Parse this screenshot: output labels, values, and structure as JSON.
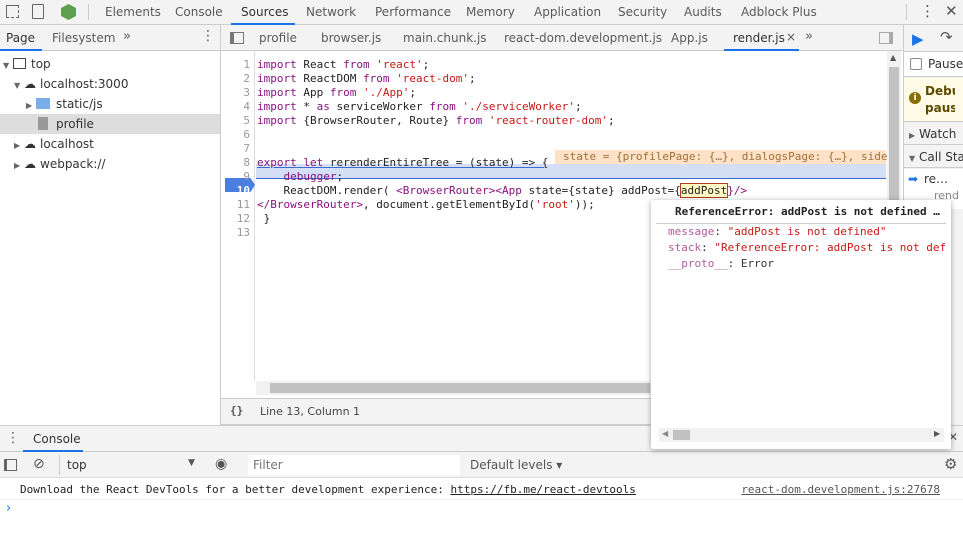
{
  "toolbar": {
    "tabs": [
      "Elements",
      "Console",
      "Sources",
      "Network",
      "Performance",
      "Memory",
      "Application",
      "Security",
      "Audits",
      "Adblock Plus"
    ],
    "active": "Sources"
  },
  "navigator": {
    "tabs": [
      "Page",
      "Filesystem"
    ],
    "more": "»",
    "tree": [
      "top",
      "localhost:3000",
      "static/js",
      "profile",
      "localhost",
      "webpack://"
    ]
  },
  "editor": {
    "tabs": [
      "profile",
      "browser.js",
      "main.chunk.js",
      "react-dom.development.js",
      "App.js",
      "render.js"
    ],
    "active_tab": "render.js",
    "close": "×",
    "more": "»",
    "lines": [
      [
        [
          "import",
          "kw"
        ],
        [
          " React ",
          "id"
        ],
        [
          "from",
          "kw"
        ],
        [
          " 'react'",
          "str"
        ],
        [
          ";",
          "id"
        ]
      ],
      [
        [
          "import",
          "kw"
        ],
        [
          " ReactDOM ",
          "id"
        ],
        [
          "from",
          "kw"
        ],
        [
          " 'react-dom'",
          "str"
        ],
        [
          ";",
          "id"
        ]
      ],
      [
        [
          "import",
          "kw"
        ],
        [
          " App ",
          "id"
        ],
        [
          "from",
          "kw"
        ],
        [
          " './App'",
          "str"
        ],
        [
          ";",
          "id"
        ]
      ],
      [
        [
          "import",
          "kw"
        ],
        [
          " * ",
          "id"
        ],
        [
          "as",
          "kw"
        ],
        [
          " serviceWorker ",
          "id"
        ],
        [
          "from",
          "kw"
        ],
        [
          " './serviceWorker'",
          "str"
        ],
        [
          ";",
          "id"
        ]
      ],
      [
        [
          "import",
          "kw"
        ],
        [
          " {BrowserRouter, Route} ",
          "id"
        ],
        [
          "from",
          "kw"
        ],
        [
          " 'react-router-dom'",
          "str"
        ],
        [
          ";",
          "id"
        ]
      ],
      [],
      [],
      [
        [
          "export",
          "kw"
        ],
        [
          " ",
          "id"
        ],
        [
          "let",
          "kw"
        ],
        [
          " rerenderEntireTree = (state) => {",
          "id"
        ]
      ],
      [
        [
          "    ",
          "id"
        ],
        [
          "debugger",
          "kw"
        ],
        [
          ";",
          "id"
        ]
      ],
      [
        [
          "    ReactDOM.render( ",
          "id"
        ],
        [
          "<BrowserRouter>",
          "tag"
        ],
        [
          "<App ",
          "tag"
        ],
        [
          "state={state} addPost={",
          "id"
        ],
        [
          "addPost",
          "id"
        ],
        [
          "}/>",
          "tag"
        ]
      ],
      [
        [
          "</BrowserRouter>",
          "tag"
        ],
        [
          ", document.getElementById(",
          "id"
        ],
        [
          "'root'",
          "str"
        ],
        [
          "));",
          "id"
        ]
      ],
      [
        [
          " }",
          "id"
        ]
      ],
      []
    ],
    "inline_value": "state = {profilePage: {…}, dialogsPage: {…}, side",
    "status": "Line 13, Column 1",
    "format": "{}"
  },
  "popover": {
    "title": "ReferenceError: addPost is not defined …",
    "props": [
      {
        "k": "message",
        "v": "\"addPost is not defined\""
      },
      {
        "k": "stack",
        "v": "\"ReferenceError: addPost is not def"
      }
    ],
    "proto_k": "__proto__",
    "proto_v": "Error"
  },
  "debugger": {
    "pause_label": "Pause…",
    "banner": "Debugger paused",
    "watch": "Watch",
    "callstack": "Call Stack",
    "frame": "re…",
    "frame_sub": "rend"
  },
  "console": {
    "tab": "Console",
    "context": "top",
    "filter_placeholder": "Filter",
    "levels": "Default levels ▾",
    "message": "Download the React DevTools for a better development experience: ",
    "link": "https://fb.me/react-devtools",
    "source": "react-dom.development.js:27678",
    "prompt": "›"
  }
}
